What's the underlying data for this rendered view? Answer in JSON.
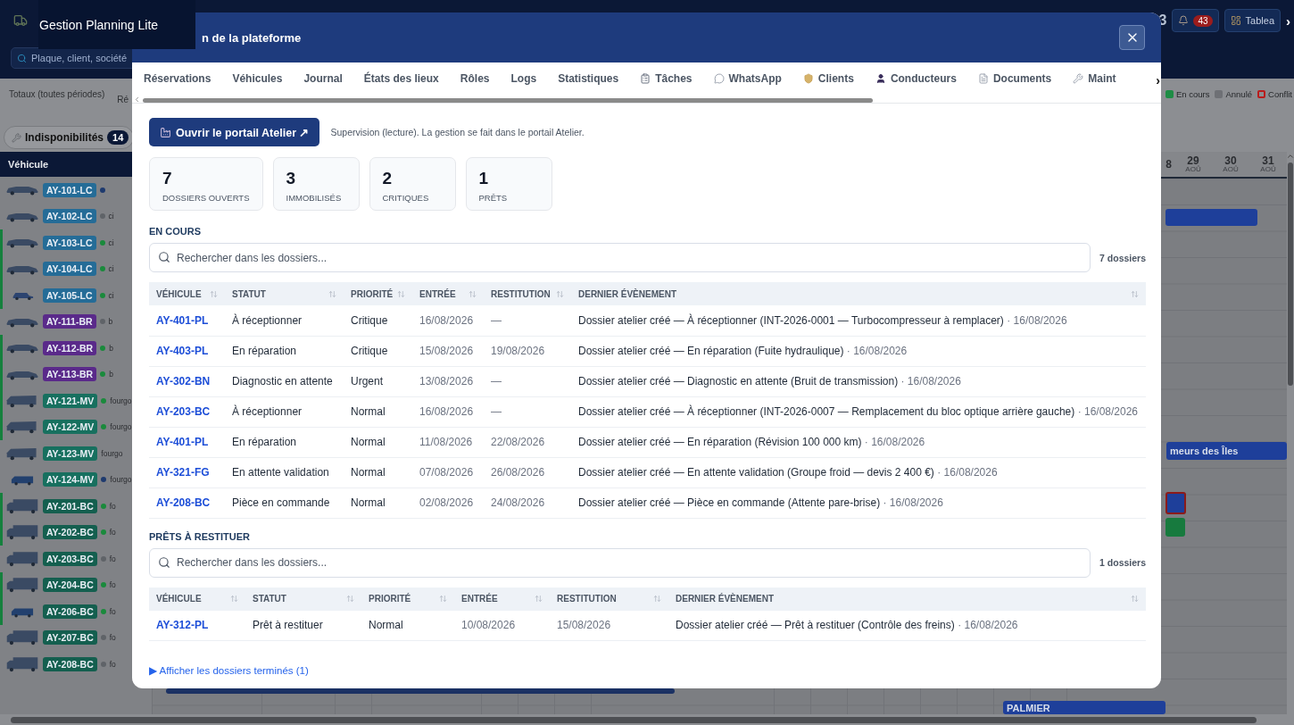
{
  "app": {
    "title": "Gestion Planning Lite",
    "search": {
      "placeholder": "Plaque, client, société"
    },
    "counter": "3",
    "alerts": {
      "badge": "43"
    },
    "dashboard_button": "Tablea",
    "more": "›",
    "totals_label": "Totaux (toutes périodes)",
    "totals_column": "Ré",
    "legend": [
      {
        "label": "En cours",
        "color": "#1e8c45",
        "kind": "fill"
      },
      {
        "label": "Annulé",
        "color": "#6e7075",
        "kind": "fill"
      },
      {
        "label": "Conflit",
        "color": "#b91c1c",
        "kind": "outline"
      }
    ],
    "unavailability_tab": {
      "label": "Indisponibilités",
      "count": "14"
    },
    "vehicle_header": "Véhicule",
    "vehicles": [
      {
        "plate": "AY-101-LC",
        "kind": "car",
        "color": "#256c97",
        "status": {
          "color": "#1e3a6e"
        },
        "active": false
      },
      {
        "plate": "AY-102-LC",
        "kind": "car",
        "color": "#256c97",
        "status": {
          "color": "#5f6368"
        },
        "type": "ci",
        "active": false
      },
      {
        "plate": "AY-103-LC",
        "kind": "car",
        "color": "#256c97",
        "status": {
          "color": "#1a8a3c"
        },
        "type": "ci",
        "active": true
      },
      {
        "plate": "AY-104-LC",
        "kind": "car",
        "color": "#256c97",
        "status": {
          "color": "#1a8a3c"
        },
        "type": "ci",
        "active": true
      },
      {
        "plate": "AY-105-LC",
        "kind": "small-car",
        "color": "#256c97",
        "status": {
          "color": "#1a8a3c"
        },
        "type": "ci",
        "active": true
      },
      {
        "plate": "AY-111-BR",
        "kind": "car",
        "color": "#5a2a8a",
        "status": {
          "color": "#5f6368"
        },
        "type": "b",
        "active": false
      },
      {
        "plate": "AY-112-BR",
        "kind": "car",
        "color": "#5a2a8a",
        "status": {
          "color": "#1a8a3c"
        },
        "type": "b",
        "active": true
      },
      {
        "plate": "AY-113-BR",
        "kind": "car",
        "color": "#5a2a8a",
        "status": {
          "color": "#1a8a3c"
        },
        "type": "b",
        "active": true
      },
      {
        "plate": "AY-121-MV",
        "kind": "van",
        "color": "#17705f",
        "status": {
          "color": "#1a8a3c"
        },
        "type": "fourgo",
        "active": true
      },
      {
        "plate": "AY-122-MV",
        "kind": "van",
        "color": "#17705f",
        "status": {
          "color": "#1a8a3c"
        },
        "type": "fourgo",
        "active": true
      },
      {
        "plate": "AY-123-MV",
        "kind": "van",
        "color": "#17705f",
        "type": "fourgo",
        "active": false
      },
      {
        "plate": "AY-124-MV",
        "kind": "small-van",
        "color": "#17705f",
        "status": {
          "color": "#1e3a6e"
        },
        "type": "fourgo",
        "active": false
      },
      {
        "plate": "AY-201-BC",
        "kind": "truck",
        "color": "#145f4f",
        "status": {
          "color": "#1a8a3c"
        },
        "type": "fo",
        "active": true
      },
      {
        "plate": "AY-202-BC",
        "kind": "truck",
        "color": "#145f4f",
        "status": {
          "color": "#1a8a3c"
        },
        "type": "fo",
        "active": true
      },
      {
        "plate": "AY-203-BC",
        "kind": "truck",
        "color": "#145f4f",
        "status": {
          "color": "#5f6368"
        },
        "type": "fo",
        "active": false
      },
      {
        "plate": "AY-204-BC",
        "kind": "truck",
        "color": "#145f4f",
        "status": {
          "color": "#1a8a3c"
        },
        "type": "fo",
        "active": true
      },
      {
        "plate": "AY-206-BC",
        "kind": "small-van",
        "color": "#145f4f",
        "status": {
          "color": "#1a8a3c"
        },
        "type": "fo",
        "active": true
      },
      {
        "plate": "AY-207-BC",
        "kind": "truck",
        "color": "#145f4f",
        "status": {
          "color": "#5f6368"
        },
        "type": "fo",
        "active": false
      },
      {
        "plate": "AY-208-BC",
        "kind": "truck",
        "color": "#145f4f",
        "status": {
          "color": "#5f6368"
        },
        "type": "fo",
        "active": false
      }
    ],
    "timeline": {
      "dates": [
        {
          "day": "8"
        },
        {
          "day": "29",
          "month": "AOÛ"
        },
        {
          "day": "30",
          "month": "AOÛ"
        },
        {
          "day": "31",
          "month": "AOÛ"
        }
      ],
      "bars": [
        {
          "color": "#1e3f9a",
          "conflict": false
        },
        {
          "label": "meurs des Îles",
          "color": "#1e3f9a",
          "conflict": false
        },
        {
          "color": "#1e3f9a",
          "conflict": true
        },
        {
          "color": "#177a3e",
          "conflict": false
        },
        {
          "color": "#1b3163",
          "conflict": false
        },
        {
          "label": "PALMIER",
          "color": "#1e3f9a",
          "conflict": false
        }
      ]
    }
  },
  "modal": {
    "title": "n de la plateforme",
    "tabs": [
      {
        "label": "Réservations",
        "selected": false
      },
      {
        "label": "Véhicules",
        "selected": false
      },
      {
        "label": "Journal",
        "selected": false
      },
      {
        "label": "États des lieux",
        "selected": false
      },
      {
        "label": "Rôles",
        "selected": false
      },
      {
        "label": "Logs",
        "selected": false
      },
      {
        "label": "Statistiques",
        "selected": false
      },
      {
        "label": "Tâches",
        "selected": false
      },
      {
        "label": "WhatsApp",
        "selected": false
      },
      {
        "label": "Clients",
        "selected": false
      },
      {
        "label": "Conducteurs",
        "selected": false
      },
      {
        "label": "Documents",
        "selected": false
      },
      {
        "label": "Maint",
        "selected": false
      }
    ],
    "tabs_next": "›",
    "portal_button": "Ouvrir le portail Atelier ↗",
    "note": "Supervision (lecture). La gestion se fait dans le portail Atelier.",
    "stats": [
      {
        "value": "7",
        "label": "DOSSIERS OUVERTS"
      },
      {
        "value": "3",
        "label": "IMMOBILISÉS"
      },
      {
        "value": "2",
        "label": "CRITIQUES"
      },
      {
        "value": "1",
        "label": "PRÊTS"
      }
    ],
    "sections": [
      {
        "title": "EN COURS",
        "search": {
          "placeholder": "Rechercher dans les dossiers..."
        },
        "count": "7 dossiers",
        "columns": [
          "VÉHICULE",
          "STATUT",
          "PRIORITÉ",
          "ENTRÉE",
          "RESTITUTION",
          "DERNIER ÉVÈNEMENT"
        ],
        "rows": [
          {
            "vehicle": "AY-401-PL",
            "status": "À réceptionner",
            "priority": "Critique",
            "entry": "16/08/2026",
            "return": "—",
            "event": "Dossier atelier créé — À réceptionner (INT-2026-0001 — Turbocompresseur à remplacer)",
            "event_date": "· 16/08/2026"
          },
          {
            "vehicle": "AY-403-PL",
            "status": "En réparation",
            "priority": "Critique",
            "entry": "15/08/2026",
            "return": "19/08/2026",
            "event": "Dossier atelier créé — En réparation (Fuite hydraulique)",
            "event_date": "· 16/08/2026"
          },
          {
            "vehicle": "AY-302-BN",
            "status": "Diagnostic en attente",
            "priority": "Urgent",
            "entry": "13/08/2026",
            "return": "—",
            "event": "Dossier atelier créé — Diagnostic en attente (Bruit de transmission)",
            "event_date": "· 16/08/2026"
          },
          {
            "vehicle": "AY-203-BC",
            "status": "À réceptionner",
            "priority": "Normal",
            "entry": "16/08/2026",
            "return": "—",
            "event": "Dossier atelier créé — À réceptionner (INT-2026-0007 — Remplacement du bloc optique arrière gauche)",
            "event_date": "· 16/08/2026"
          },
          {
            "vehicle": "AY-401-PL",
            "status": "En réparation",
            "priority": "Normal",
            "entry": "11/08/2026",
            "return": "22/08/2026",
            "event": "Dossier atelier créé — En réparation (Révision 100 000 km)",
            "event_date": "· 16/08/2026"
          },
          {
            "vehicle": "AY-321-FG",
            "status": "En attente validation",
            "priority": "Normal",
            "entry": "07/08/2026",
            "return": "26/08/2026",
            "event": "Dossier atelier créé — En attente validation (Groupe froid — devis 2 400 €)",
            "event_date": "· 16/08/2026"
          },
          {
            "vehicle": "AY-208-BC",
            "status": "Pièce en commande",
            "priority": "Normal",
            "entry": "02/08/2026",
            "return": "24/08/2026",
            "event": "Dossier atelier créé — Pièce en commande (Attente pare-brise)",
            "event_date": "· 16/08/2026"
          }
        ]
      },
      {
        "title": "PRÊTS À RESTITUER",
        "search": {
          "placeholder": "Rechercher dans les dossiers..."
        },
        "count": "1 dossiers",
        "columns": [
          "VÉHICULE",
          "STATUT",
          "PRIORITÉ",
          "ENTRÉE",
          "RESTITUTION",
          "DERNIER ÉVÈNEMENT"
        ],
        "rows": [
          {
            "vehicle": "AY-312-PL",
            "status": "Prêt à restituer",
            "priority": "Normal",
            "entry": "10/08/2026",
            "return": "15/08/2026",
            "event": "Dossier atelier créé — Prêt à restituer (Contrôle des freins)",
            "event_date": "· 16/08/2026"
          }
        ]
      }
    ],
    "finished_link": "▶ Afficher les dossiers terminés (1)"
  }
}
